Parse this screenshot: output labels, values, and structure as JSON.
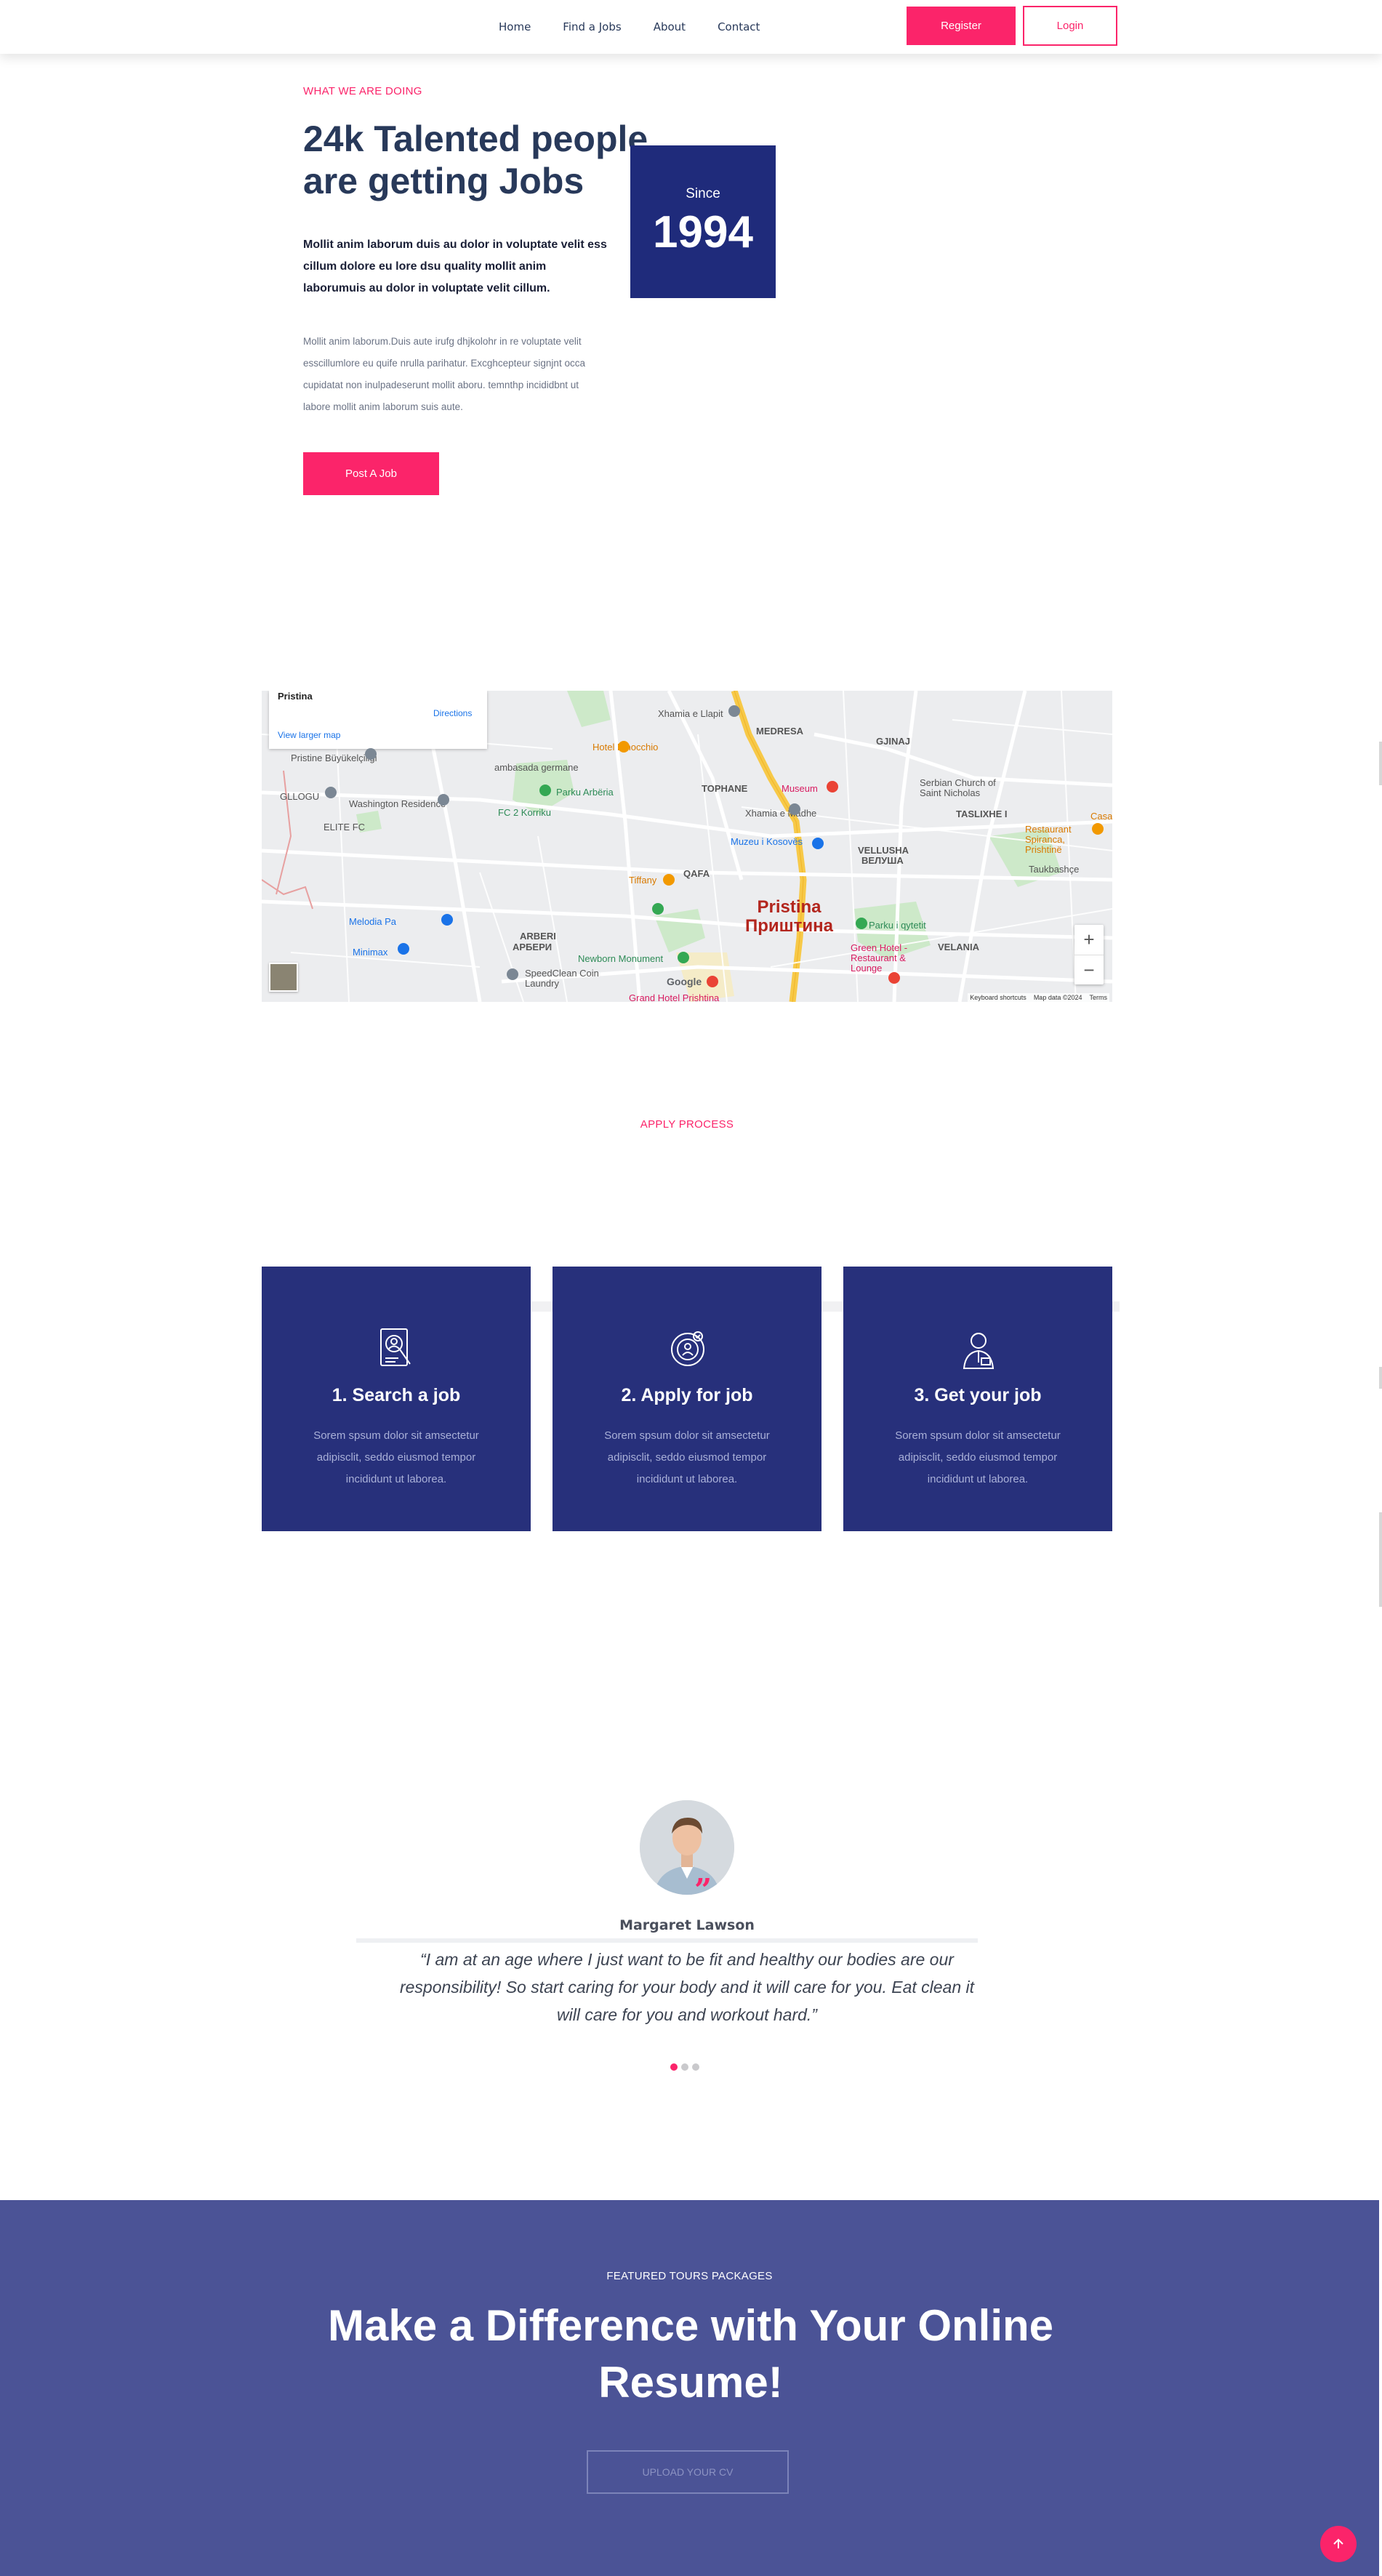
{
  "header": {
    "nav": [
      "Home",
      "Find a Jobs",
      "About",
      "Contact"
    ],
    "register_label": "Register",
    "login_label": "Login"
  },
  "about": {
    "eyebrow": "WHAT WE ARE DOING",
    "title": "24k Talented people are getting Jobs",
    "bold_text": "Mollit anim laborum duis au dolor in voluptate velit ess cillum dolore eu lore dsu quality mollit anim laborumuis au dolor in voluptate velit cillum.",
    "paragraph": "Mollit anim laborum.Duis aute irufg dhjkolohr in re voluptate velit esscillumlore eu quife nrulla parihatur. Excghcepteur signjnt occa cupidatat non inulpadeserunt mollit aboru. temnthp incididbnt ut labore mollit anim laborum suis aute.",
    "post_button": "Post A Job",
    "since_label": "Since",
    "since_year": "1994"
  },
  "map": {
    "place": "Pristina",
    "directions": "Directions",
    "view_larger": "View larger map",
    "city_name": "Pristina",
    "city_name_cyr": "Приштина",
    "labels": {
      "l1": "Xhamia e Llapit",
      "l2": "MEDRESA",
      "l3": "GJINAJ",
      "l4": "Pristine Büyükelçiliği",
      "l5": "Hotel Pinocchio",
      "l6": "ambasada germane",
      "l7": "GLLOGU",
      "l8": "Washington Residence",
      "l9": "TOPHANE",
      "l10": "Museum",
      "l11": "Serbian Church of Saint Nicholas",
      "l12": "FC 2 Korriku",
      "l13": "Parku Arbëria",
      "l14": "Xhamia e Madhe",
      "l15": "TASLIXHE I",
      "l16": "ELITE FC",
      "l17": "Muzeu i Kosovës",
      "l18": "VELLUSHA",
      "l19": "ВЕЛУША",
      "l20": "Restaurant Spiranca, Prishtinë",
      "l21": "QAFA",
      "l22": "Taukbashçe",
      "l23": "Tiffany",
      "l24": "Melodia Pa",
      "l25": "Parku i qytetit",
      "l26": "Minimax",
      "l27": "ARBERI",
      "l28": "АРБЕРИ",
      "l29": "Green Hotel - Restaurant & Lounge",
      "l30": "VELANIA",
      "l31": "Newborn Monument",
      "l32": "SpeedClean Coin Laundry",
      "l33": "Grand Hotel Prishtina",
      "l34": "Casa"
    },
    "zoom_in": "+",
    "zoom_out": "−",
    "attrib": [
      "Keyboard shortcuts",
      "Map data ©2024",
      "Terms"
    ],
    "google": "Google"
  },
  "process": {
    "eyebrow": "APPLY PROCESS",
    "cards": [
      {
        "title": "1. Search a job",
        "text": "Sorem spsum dolor sit amsectetur adipisclit, seddo eiusmod tempor incididunt ut laborea."
      },
      {
        "title": "2. Apply for job",
        "text": "Sorem spsum dolor sit amsectetur adipisclit, seddo eiusmod tempor incididunt ut laborea."
      },
      {
        "title": "3. Get your job",
        "text": "Sorem spsum dolor sit amsectetur adipisclit, seddo eiusmod tempor incididunt ut laborea."
      }
    ]
  },
  "testimonial": {
    "name": "Margaret Lawson",
    "quote": "“I am at an age where I just want to be fit and healthy our bodies are our responsibility! So start caring for your body and it will care for you. Eat clean it will care for you and workout hard.”",
    "quote_icon": "quote-icon",
    "active_slide": 1,
    "slide_count": 3
  },
  "cta": {
    "eyebrow": "FEATURED TOURS PACKAGES",
    "title": "Make a Difference with Your Online Resume!",
    "button": "UPLOAD YOUR CV"
  },
  "colors": {
    "accent": "#fb246a",
    "navy": "#27307b",
    "cta_bg": "#4b5396",
    "heading": "#28395a"
  }
}
